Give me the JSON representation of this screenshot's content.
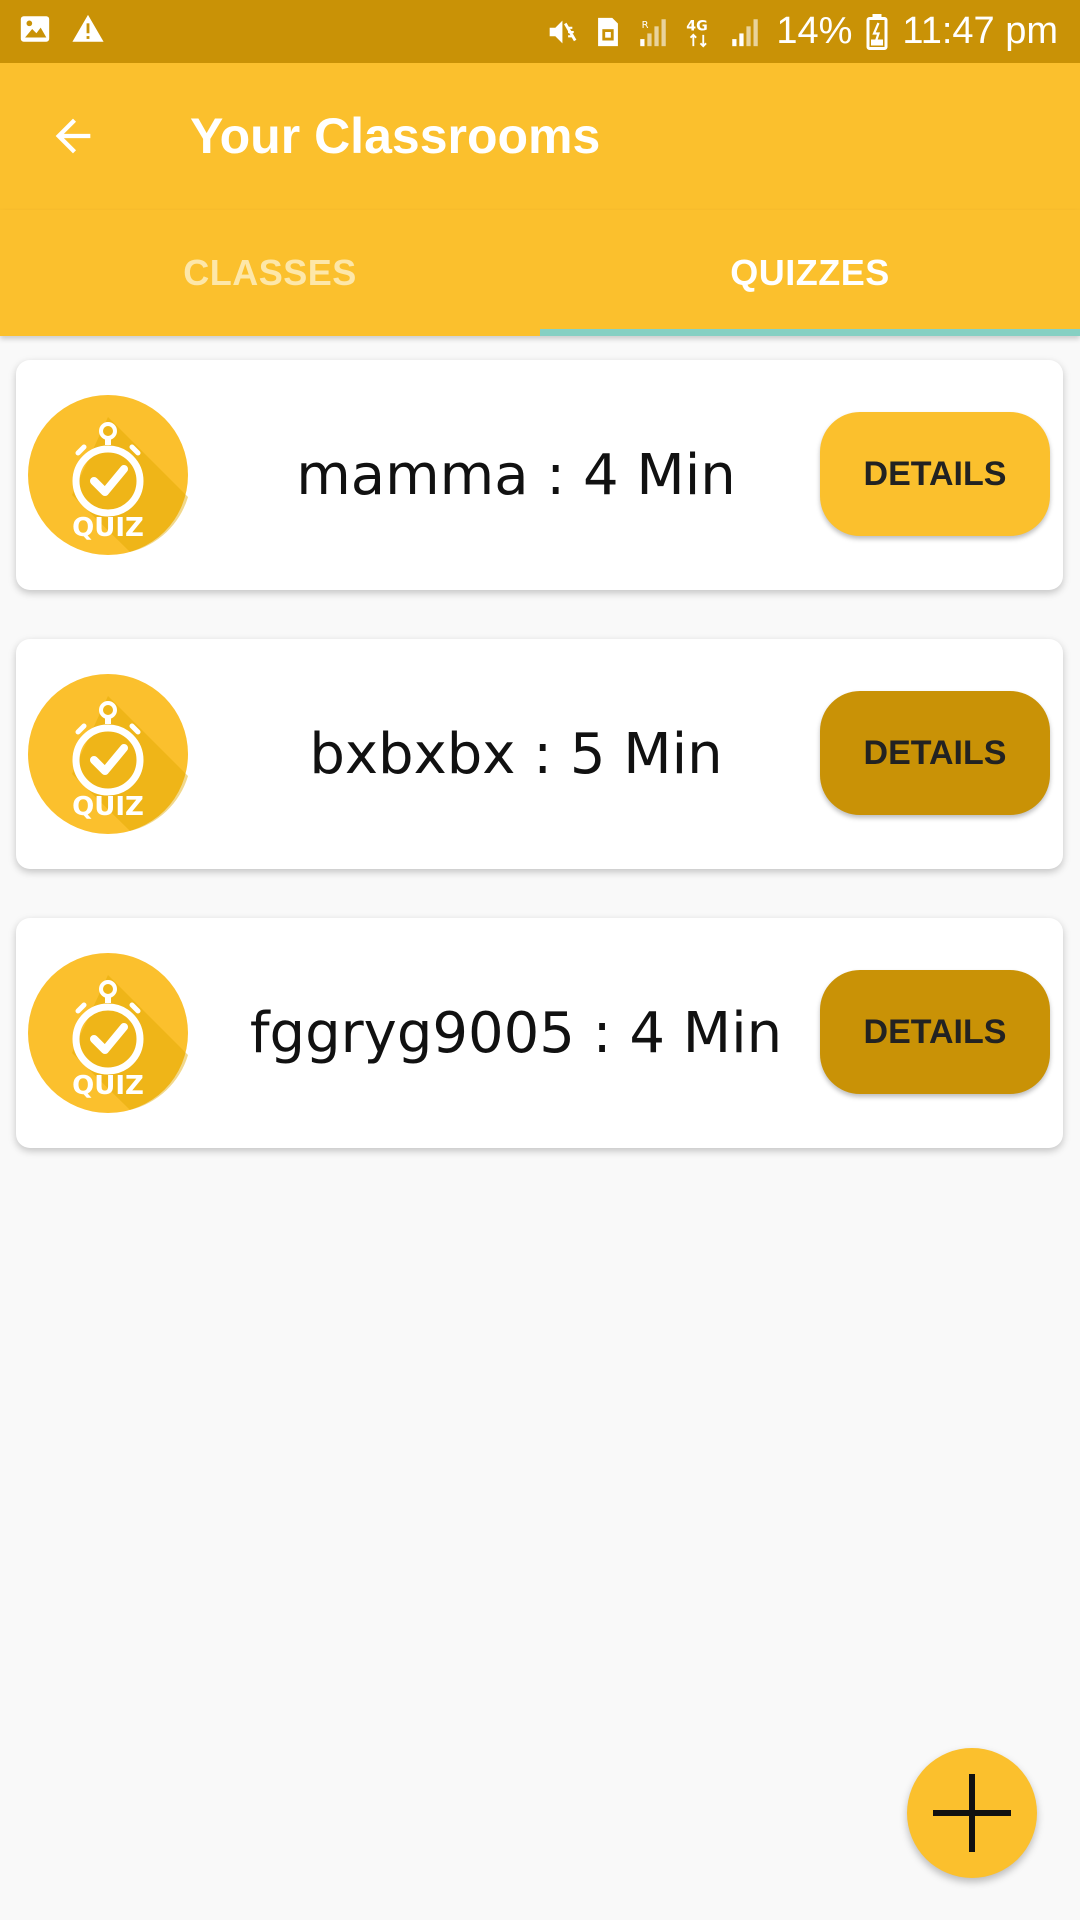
{
  "status_bar": {
    "battery": "14%",
    "time": "11:47 pm",
    "icons": [
      "image-icon",
      "warning-icon",
      "vibrate-icon",
      "sim-icon",
      "signal-icon",
      "4g-icon",
      "signal-icon",
      "battery-icon"
    ]
  },
  "app_bar": {
    "title": "Your Classrooms",
    "back_icon": "arrow-back-icon"
  },
  "tabs": [
    {
      "label": "CLASSES",
      "selected": false
    },
    {
      "label": "QUIZZES",
      "selected": true
    }
  ],
  "quizzes": [
    {
      "title": "mamma : 4 Min",
      "badge_text": "QUIZ",
      "button_label": "DETAILS",
      "button_color": "#fbc02d"
    },
    {
      "title": "bxbxbx : 5 Min",
      "badge_text": "QUIZ",
      "button_label": "DETAILS",
      "button_color": "#c99206"
    },
    {
      "title": "fggryg9005 : 4 Min",
      "badge_text": "QUIZ",
      "button_label": "DETAILS",
      "button_color": "#c99206"
    }
  ],
  "fab": {
    "icon": "plus-icon"
  },
  "colors": {
    "status_bar": "#c99206",
    "primary": "#fbc02d",
    "tab_indicator": "#86d0c3",
    "badge": "#fbc02d"
  }
}
